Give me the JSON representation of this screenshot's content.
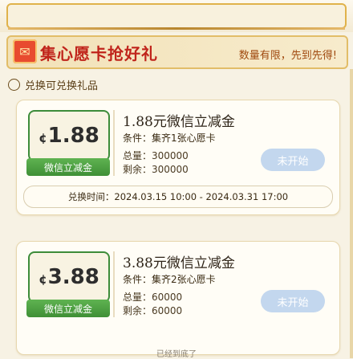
{
  "header": {
    "icon": "gift-box-icon",
    "title": "集心愿卡抢好礼",
    "subtitle": "数量有限，先到先得!"
  },
  "section": {
    "title": "兑换可兑换礼品"
  },
  "coupons": [
    {
      "amount_symbol": "¢",
      "amount_value": "1.88",
      "badge": "微信立减金",
      "name": "1.88元微信立减金",
      "condition": "条件：集齐1张心愿卡",
      "total": "总量：300000",
      "remaining": "剩余：300000",
      "button": "未开始",
      "time_range": "兑换时间：2024.03.15 10:00 - 2024.03.31 17:00"
    },
    {
      "amount_symbol": "¢",
      "amount_value": "3.88",
      "badge": "微信立减金",
      "name": "3.88元微信立减金",
      "condition": "条件：集齐2张心愿卡",
      "total": "总量：60000",
      "remaining": "剩余：60000",
      "button": "未开始"
    }
  ],
  "footer": {
    "hint": "已经到底了"
  },
  "colors": {
    "accent_red": "#c0241b",
    "badge_green": "#3f8f36",
    "button_disabled": "#c3d7ee",
    "frame_gold": "#e2bd68"
  }
}
